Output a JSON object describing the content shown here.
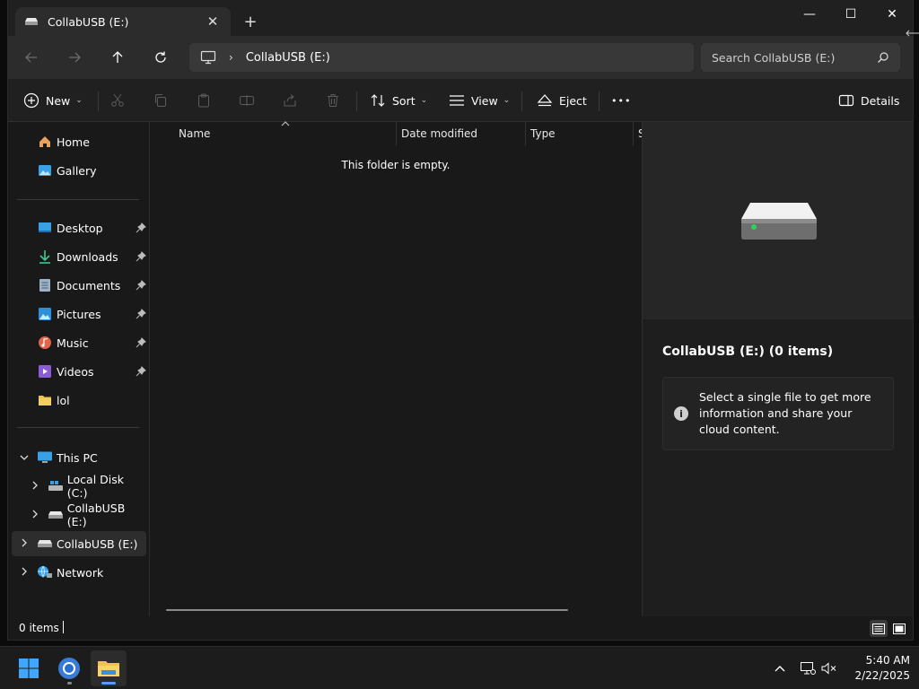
{
  "window": {
    "tab_title": "CollabUSB (E:)",
    "new_tab_symbol": "+",
    "controls": {
      "minimize": "—",
      "maximize": "☐",
      "close": "✕"
    }
  },
  "nav": {
    "breadcrumb": "CollabUSB (E:)",
    "separator": "›",
    "search_placeholder": "Search CollabUSB (E:)"
  },
  "toolbar": {
    "new_label": "New",
    "sort_label": "Sort",
    "view_label": "View",
    "eject_label": "Eject",
    "more_symbol": "•••",
    "details_label": "Details",
    "chevron": "⌄"
  },
  "sidebar": {
    "quick": [
      {
        "label": "Home",
        "icon": "home-icon"
      },
      {
        "label": "Gallery",
        "icon": "gallery-icon"
      }
    ],
    "pinned": [
      {
        "label": "Desktop",
        "icon": "desktop-icon",
        "pinned": true
      },
      {
        "label": "Downloads",
        "icon": "downloads-icon",
        "pinned": true
      },
      {
        "label": "Documents",
        "icon": "documents-icon",
        "pinned": true
      },
      {
        "label": "Pictures",
        "icon": "pictures-icon",
        "pinned": true
      },
      {
        "label": "Music",
        "icon": "music-icon",
        "pinned": true
      },
      {
        "label": "Videos",
        "icon": "videos-icon",
        "pinned": true
      },
      {
        "label": "lol",
        "icon": "folder-icon",
        "pinned": false
      }
    ],
    "tree": [
      {
        "label": "This PC",
        "icon": "pc-icon",
        "expanded": true
      },
      {
        "label": "Local Disk (C:)",
        "icon": "disk-icon"
      },
      {
        "label": "CollabUSB (E:)",
        "icon": "usb-drive-icon"
      },
      {
        "label": "CollabUSB (E:)",
        "icon": "usb-drive-icon",
        "selected": true
      },
      {
        "label": "Network",
        "icon": "network-icon"
      }
    ]
  },
  "filelist": {
    "columns": [
      "Name",
      "Date modified",
      "Type",
      "S"
    ],
    "empty_message": "This folder is empty."
  },
  "details": {
    "title": "CollabUSB (E:) (0 items)",
    "info_text": "Select a single file to get more information and share your cloud content.",
    "info_symbol": "i"
  },
  "status": {
    "item_count": "0 items"
  },
  "taskbar": {
    "time": "5:40 AM",
    "date": "2/22/2025",
    "tray_chevron": "⌃"
  },
  "colors": {
    "accent": "#5b9cf5",
    "folder": "#f0c24b",
    "drive_led": "#2bd35a"
  }
}
